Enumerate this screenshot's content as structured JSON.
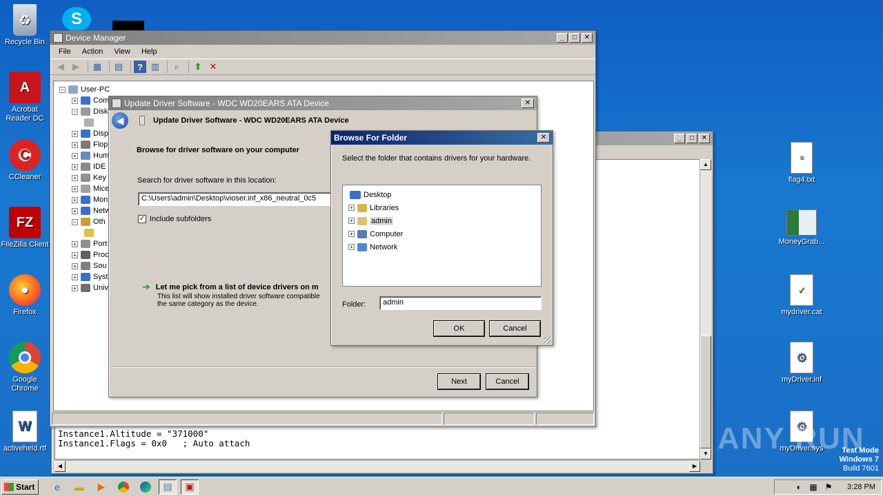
{
  "desktop": {
    "left_icons": [
      {
        "label": "Recycle Bin",
        "icon": "recycle-bin-icon"
      },
      {
        "label": "Acrobat Reader DC",
        "icon": "acrobat-icon"
      },
      {
        "label": "CCleaner",
        "icon": "ccleaner-icon"
      },
      {
        "label": "FileZilla Client",
        "icon": "filezilla-icon"
      },
      {
        "label": "Firefox",
        "icon": "firefox-icon"
      },
      {
        "label": "Google Chrome",
        "icon": "chrome-icon"
      },
      {
        "label": "activeheld.rtf",
        "icon": "word-doc-icon"
      }
    ],
    "right_icons": [
      {
        "label": "flag4.txt",
        "icon": "text-file-icon"
      },
      {
        "label": "MoneyGrab...",
        "icon": "app-window-icon"
      },
      {
        "label": "mydriver.cat",
        "icon": "catalog-file-icon"
      },
      {
        "label": "myDriver.inf",
        "icon": "setup-info-icon"
      },
      {
        "label": "myDriver.sys",
        "icon": "system-file-icon"
      }
    ],
    "watermark": "ANY RUN",
    "test_mode": [
      "Test Mode",
      "Windows 7",
      "Build 7601"
    ]
  },
  "notepad": {
    "lines": [
      "Instance1.Altitude = \"371000\"",
      "Instance1.Flags = 0x0   ; Auto attach"
    ]
  },
  "device_manager": {
    "title": "Device Manager",
    "menu": [
      "File",
      "Action",
      "View",
      "Help"
    ],
    "tree_root": "User-PC",
    "tree": [
      {
        "label": "Com",
        "color": "#3a6fd0"
      },
      {
        "label": "Disk",
        "color": "#9a9a9a"
      },
      {
        "label": "",
        "color": "#b0b0b0"
      },
      {
        "label": "Disp",
        "color": "#3a6fd0"
      },
      {
        "label": "Flop",
        "color": "#7a7a7a"
      },
      {
        "label": "Hum",
        "color": "#6a8ac0"
      },
      {
        "label": "IDE",
        "color": "#8a8a8a"
      },
      {
        "label": "Key",
        "color": "#909090"
      },
      {
        "label": "Mice",
        "color": "#a0a0a0"
      },
      {
        "label": "Mon",
        "color": "#3a6fd0"
      },
      {
        "label": "Netw",
        "color": "#3a6fd0"
      },
      {
        "label": "Oth",
        "color": "#c8a030"
      },
      {
        "label": "",
        "color": "#e0c040"
      },
      {
        "label": "Port",
        "color": "#909090"
      },
      {
        "label": "Proc",
        "color": "#606060"
      },
      {
        "label": "Sou",
        "color": "#808080"
      },
      {
        "label": "Syst",
        "color": "#3a6fd0"
      },
      {
        "label": "Univ",
        "color": "#707070"
      }
    ]
  },
  "update_driver": {
    "window_title": "Update Driver Software - WDC WD20EARS ATA Device",
    "header": "Update Driver Software - WDC WD20EARS ATA Device",
    "heading": "Browse for driver software on your computer",
    "search_label": "Search for driver software in this location:",
    "path_value": "C:\\Users\\admin\\Desktop\\vioser.inf_x86_neutral_0c5",
    "include_subfolders": "Include subfolders",
    "pick_link": "Let me pick from a list of device drivers on m",
    "pick_desc_1": "This list will show installed driver software compatible",
    "pick_desc_2": "the same category as the device.",
    "next": "Next",
    "cancel": "Cancel"
  },
  "browse": {
    "title": "Browse For Folder",
    "instruction": "Select the folder that contains drivers for your hardware.",
    "tree": [
      "Desktop",
      "Libraries",
      "admin",
      "Computer",
      "Network"
    ],
    "folder_label": "Folder:",
    "folder_value": "admin",
    "ok": "OK",
    "cancel": "Cancel"
  },
  "taskbar": {
    "start": "Start",
    "apps": [
      "ie-icon",
      "explorer-icon",
      "media-player-icon",
      "chrome-icon",
      "edge-icon",
      "notepad-icon",
      "device-manager-icon"
    ],
    "clock": "3:28 PM"
  }
}
